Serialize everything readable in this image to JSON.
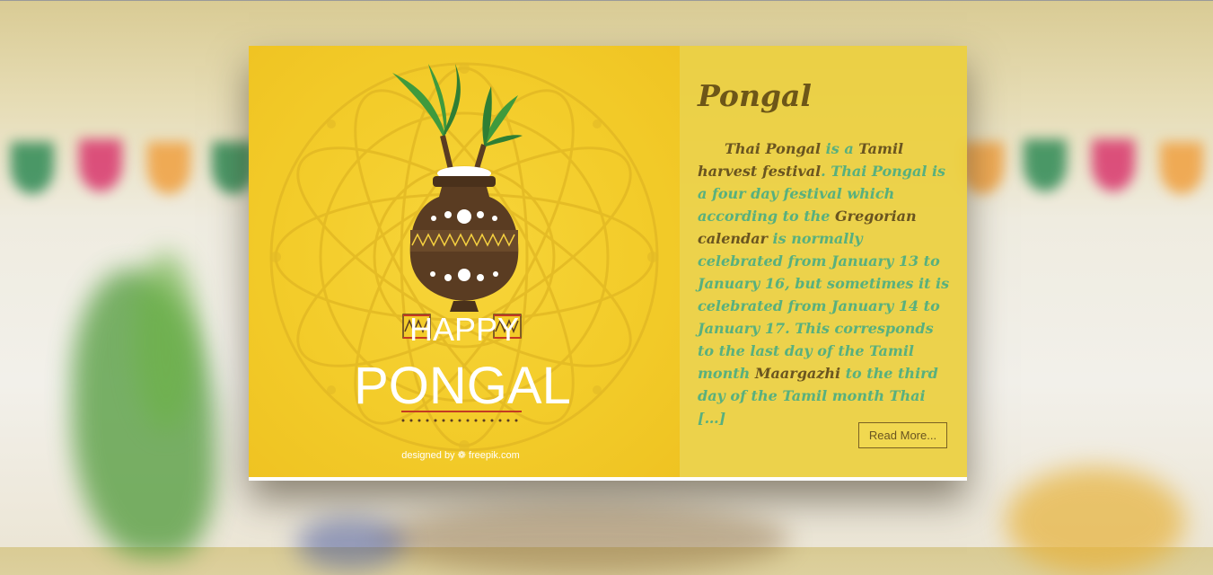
{
  "post": {
    "title": "Pongal",
    "paragraph": [
      {
        "text": "Thai Pongal",
        "type": "link"
      },
      {
        "text": " is a ",
        "type": "plain"
      },
      {
        "text": "Tamil harvest festival",
        "type": "link"
      },
      {
        "text": ". ",
        "type": "plain"
      },
      {
        "text": "Thai Pongal is a four day festival which according to the ",
        "type": "plain"
      },
      {
        "text": "Gregorian calendar",
        "type": "link"
      },
      {
        "text": " is normally celebrated from January 13 to January 16, but sometimes it is celebrated from January 14 to January 17. This corresponds to the last day of the Tamil month ",
        "type": "plain"
      },
      {
        "text": "Maargazhi",
        "type": "link"
      },
      {
        "text": " to the third day of the Tamil month Thai […]",
        "type": "plain"
      }
    ],
    "read_more_label": "Read More..."
  },
  "artwork": {
    "greeting_line1": "HAPPY",
    "greeting_line2": "PONGAL",
    "credit": "designed by ❁ freepik.com"
  },
  "colors": {
    "panel": "#ecd03e",
    "title": "#6d5618",
    "body_text": "#58b07e",
    "link_text": "#6a5520",
    "art_bg": "#f3cc2a",
    "pot": "#5a3c22"
  }
}
